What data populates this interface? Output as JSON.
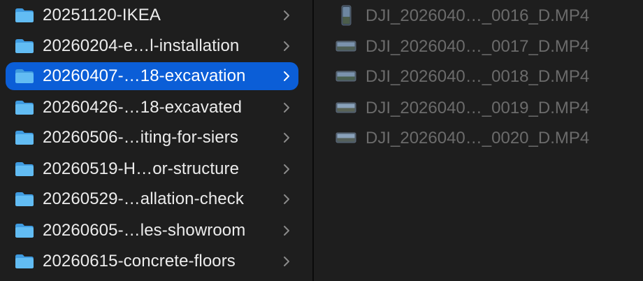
{
  "colors": {
    "background": "#1e1e1e",
    "selection": "#0b5ed7",
    "folder_blue": "#5ab4f0",
    "text_primary": "#ececec",
    "text_dimmed": "#6b6b6b",
    "chevron": "#8a8a8a"
  },
  "folders": [
    {
      "label": "20251120-IKEA",
      "icon": "folder-icon",
      "selected": false
    },
    {
      "label": "20260204-e…l-installation",
      "icon": "folder-icon",
      "selected": false
    },
    {
      "label": "20260407-…18-excavation",
      "icon": "folder-icon",
      "selected": true
    },
    {
      "label": "20260426-…18-excavated",
      "icon": "folder-icon",
      "selected": false
    },
    {
      "label": "20260506-…iting-for-siers",
      "icon": "folder-icon",
      "selected": false
    },
    {
      "label": "20260519-H…or-structure",
      "icon": "folder-icon",
      "selected": false
    },
    {
      "label": "20260529-…allation-check",
      "icon": "folder-icon",
      "selected": false
    },
    {
      "label": "20260605-…les-showroom",
      "icon": "folder-icon",
      "selected": false
    },
    {
      "label": "20260615-concrete-floors",
      "icon": "folder-icon",
      "selected": false
    }
  ],
  "files": [
    {
      "label": "DJI_2026040…_0016_D.MP4",
      "icon": "video-thumbnail-portrait-icon"
    },
    {
      "label": "DJI_2026040…_0017_D.MP4",
      "icon": "video-thumbnail-landscape-icon"
    },
    {
      "label": "DJI_2026040…_0018_D.MP4",
      "icon": "video-thumbnail-landscape-icon"
    },
    {
      "label": "DJI_2026040…_0019_D.MP4",
      "icon": "video-thumbnail-landscape-icon"
    },
    {
      "label": "DJI_2026040…_0020_D.MP4",
      "icon": "video-thumbnail-landscape-icon"
    }
  ]
}
